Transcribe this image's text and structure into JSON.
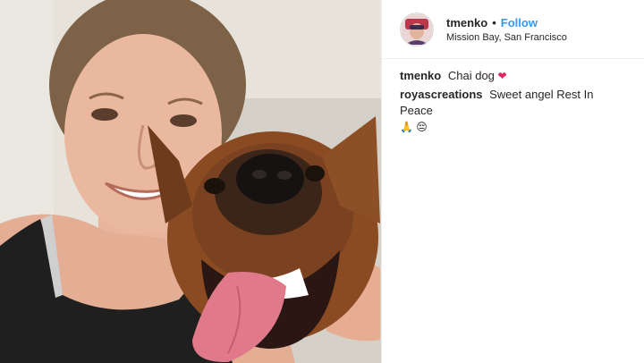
{
  "post": {
    "author": {
      "username": "tmenko",
      "separator": "•",
      "follow_label": "Follow",
      "location": "Mission Bay, San Francisco"
    },
    "comments": [
      {
        "username": "tmenko",
        "text": "Chai dog",
        "emoji": "❤"
      },
      {
        "username": "royascreations",
        "text": "Sweet angel Rest In Peace",
        "emoji": "🙏 😔"
      }
    ],
    "colors": {
      "follow": "#3897f0",
      "heart": "#e0245e",
      "divider": "#efefef"
    }
  }
}
